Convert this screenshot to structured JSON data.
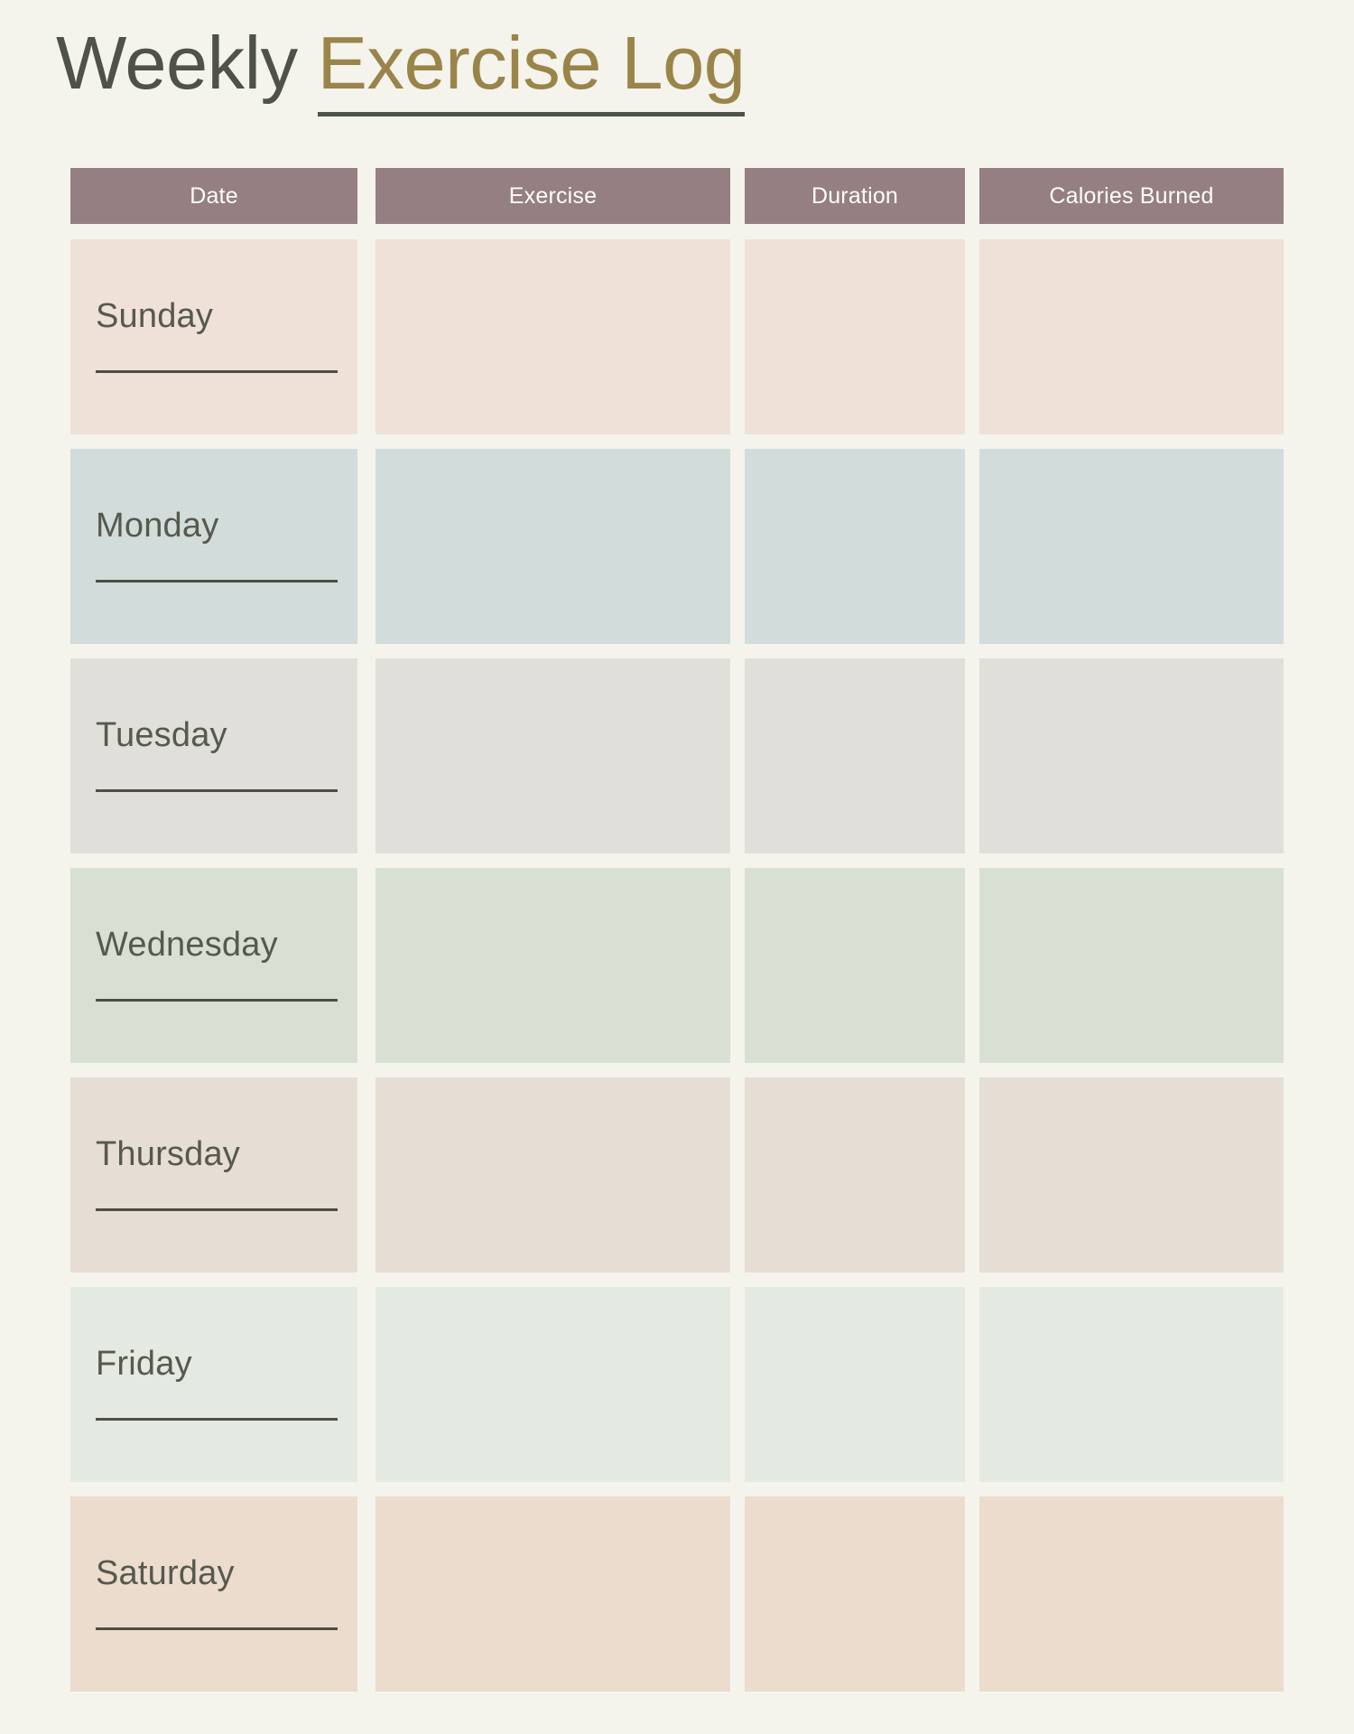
{
  "page": {
    "background_color": "#f4f4ec"
  },
  "title": {
    "primary": "Weekly",
    "accent": "Exercise Log",
    "primary_color": "#4f5248",
    "accent_color": "#9a8449",
    "underline_color": "#4f5248"
  },
  "table": {
    "header_background": "#957f82",
    "header_text_color": "#fdfdf8",
    "columns": [
      {
        "key": "date",
        "label": "Date"
      },
      {
        "key": "exercise",
        "label": "Exercise"
      },
      {
        "key": "duration",
        "label": "Duration"
      },
      {
        "key": "calories",
        "label": "Calories Burned"
      }
    ],
    "rows": [
      {
        "day": "Sunday",
        "color": "#efe1d8",
        "exercise": "",
        "duration": "",
        "calories": ""
      },
      {
        "day": "Monday",
        "color": "#d2dcda",
        "exercise": "",
        "duration": "",
        "calories": ""
      },
      {
        "day": "Tuesday",
        "color": "#e0dfda",
        "exercise": "",
        "duration": "",
        "calories": ""
      },
      {
        "day": "Wednesday",
        "color": "#d8e0d4",
        "exercise": "",
        "duration": "",
        "calories": ""
      },
      {
        "day": "Thursday",
        "color": "#e6ddd4",
        "exercise": "",
        "duration": "",
        "calories": ""
      },
      {
        "day": "Friday",
        "color": "#e4eae2",
        "exercise": "",
        "duration": "",
        "calories": ""
      },
      {
        "day": "Saturday",
        "color": "#ebdcce",
        "exercise": "",
        "duration": "",
        "calories": ""
      }
    ],
    "write_line_color": "#4c4f42",
    "day_label_color": "#56594d"
  }
}
